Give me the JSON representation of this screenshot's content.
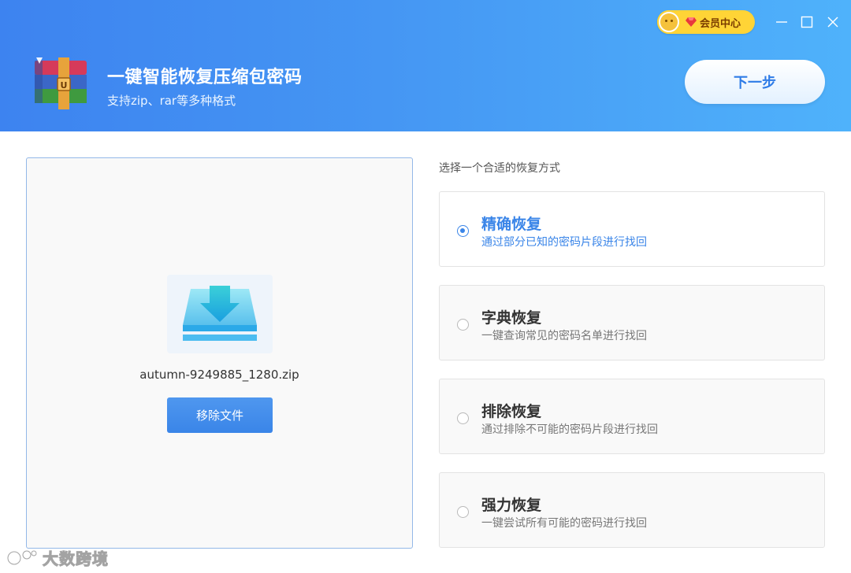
{
  "header": {
    "title": "一键智能恢复压缩包密码",
    "subtitle": "支持zip、rar等多种格式",
    "vip_label": "会员中心",
    "next_label": "下一步"
  },
  "file": {
    "name": "autumn-9249885_1280.zip",
    "remove_label": "移除文件"
  },
  "options": {
    "title": "选择一个合适的恢复方式",
    "items": [
      {
        "title": "精确恢复",
        "desc": "通过部分已知的密码片段进行找回",
        "selected": true
      },
      {
        "title": "字典恢复",
        "desc": "一键查询常见的密码名单进行找回",
        "selected": false
      },
      {
        "title": "排除恢复",
        "desc": "通过排除不可能的密码片段进行找回",
        "selected": false
      },
      {
        "title": "强力恢复",
        "desc": "一键尝试所有可能的密码进行找回",
        "selected": false
      }
    ]
  },
  "watermark": {
    "text": "大数跨境"
  },
  "colors": {
    "accent": "#3a85e8",
    "header_start": "#3d83f0",
    "header_end": "#4fb2fb",
    "vip_gold": "#ffd436"
  },
  "icons": [
    "winrar-logo-icon",
    "avatar-icon",
    "gem-icon",
    "minimize-icon",
    "maximize-icon",
    "close-icon",
    "upload-tray-icon",
    "radio-icon",
    "brand-logo-icon"
  ]
}
